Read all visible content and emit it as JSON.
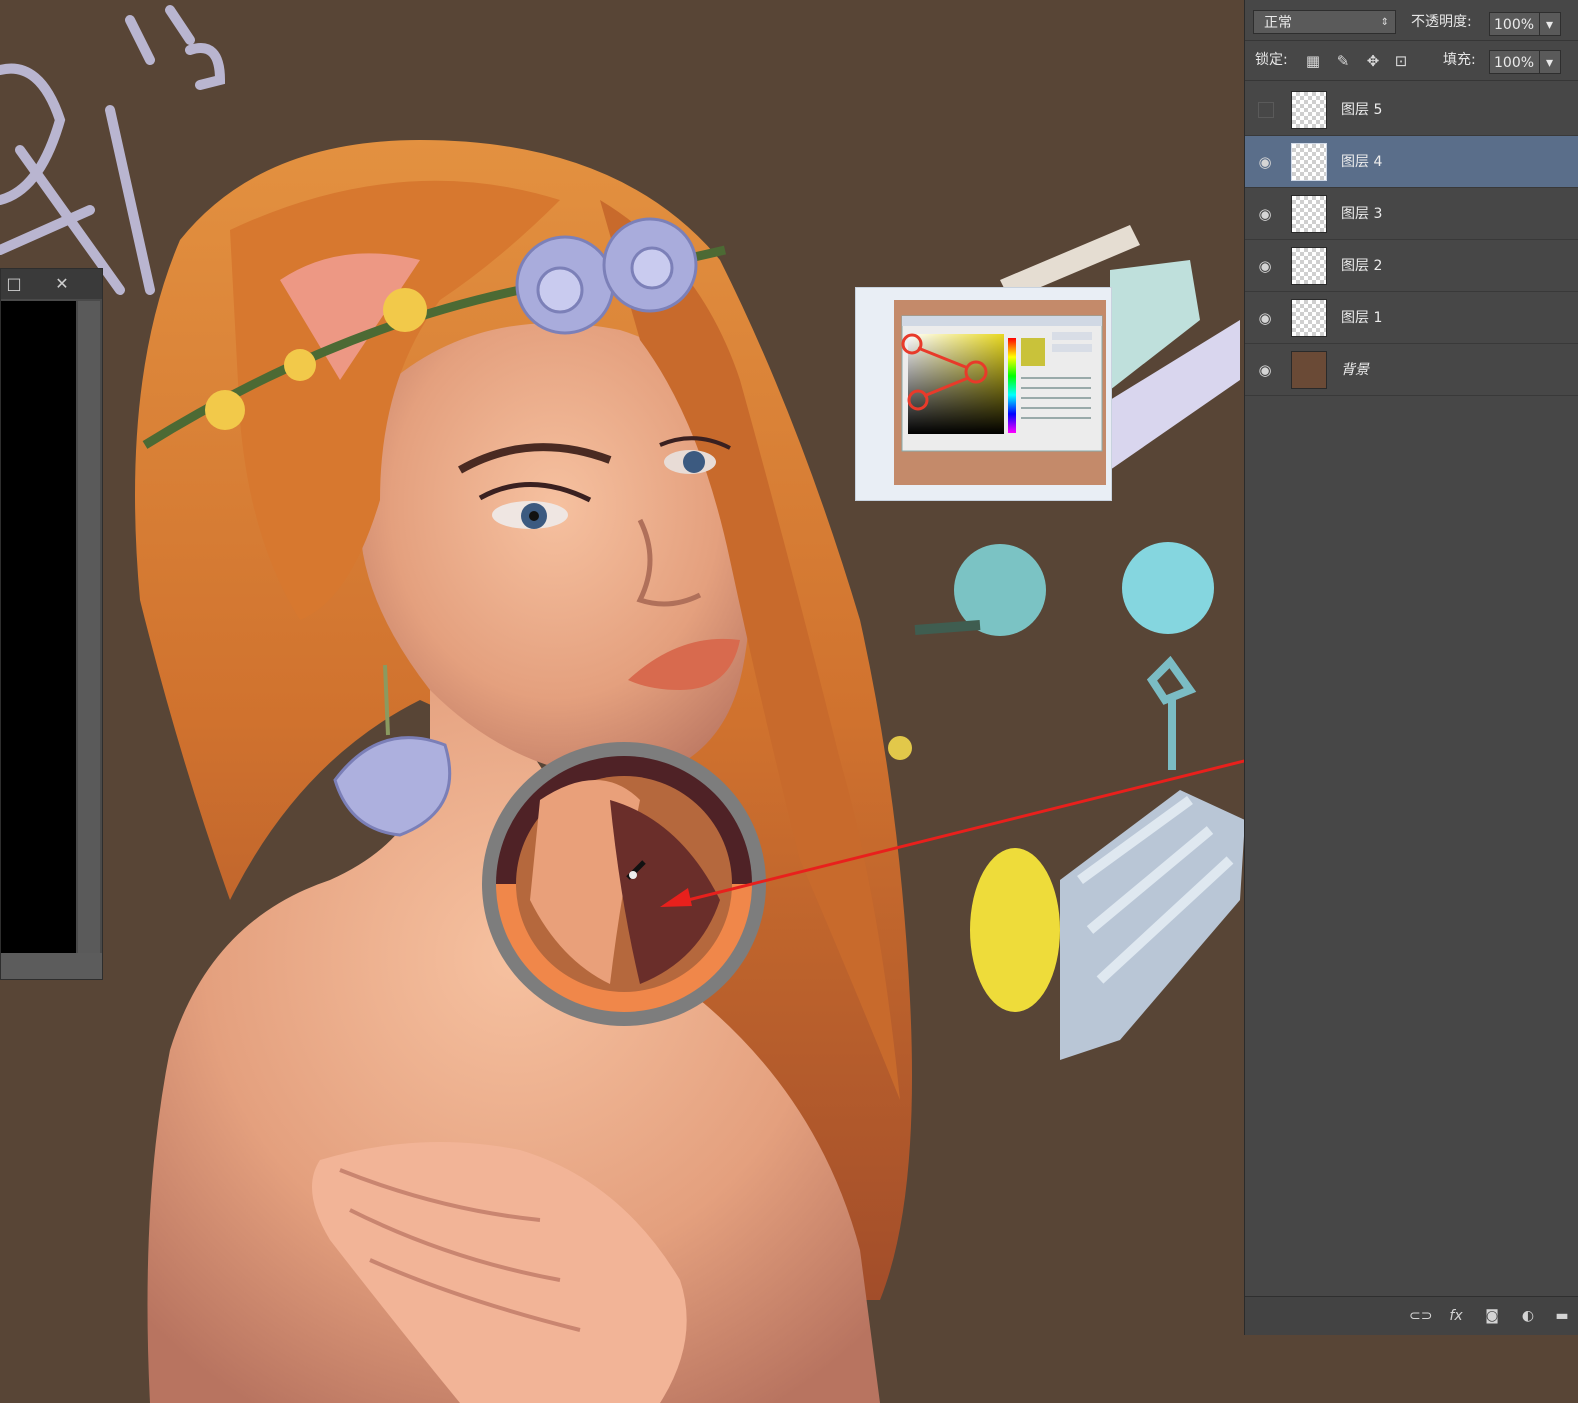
{
  "left_panel": {
    "restore_icon": "□",
    "close_icon": "✕"
  },
  "layers_panel": {
    "blend_mode": "正常",
    "opacity_label": "不透明度:",
    "opacity_value": "100%",
    "lock_label": "锁定:",
    "fill_label": "填充:",
    "fill_value": "100%",
    "lock_icons": [
      "transparency-lock-icon",
      "brush-lock-icon",
      "move-lock-icon",
      "padlock-icon"
    ],
    "layers": [
      {
        "name": "图层 5",
        "visible": false,
        "active": false
      },
      {
        "name": "图层 4",
        "visible": true,
        "active": true
      },
      {
        "name": "图层 3",
        "visible": true,
        "active": false
      },
      {
        "name": "图层 2",
        "visible": true,
        "active": false
      },
      {
        "name": "图层 1",
        "visible": true,
        "active": false
      },
      {
        "name": "背景",
        "visible": true,
        "active": false
      }
    ],
    "footer_icons": [
      "link-icon",
      "fx-icon",
      "mask-icon",
      "adjustment-icon",
      "folder-icon"
    ]
  },
  "colors": {
    "canvas_bg": "#584536",
    "panel_bg": "#474747",
    "active_layer": "#5a6e8a",
    "arrow_red": "#e8201c",
    "picker_ring_outer": "#7d7d7d",
    "picker_color_new": "#4f2226",
    "picker_color_current": "#f0874a"
  }
}
